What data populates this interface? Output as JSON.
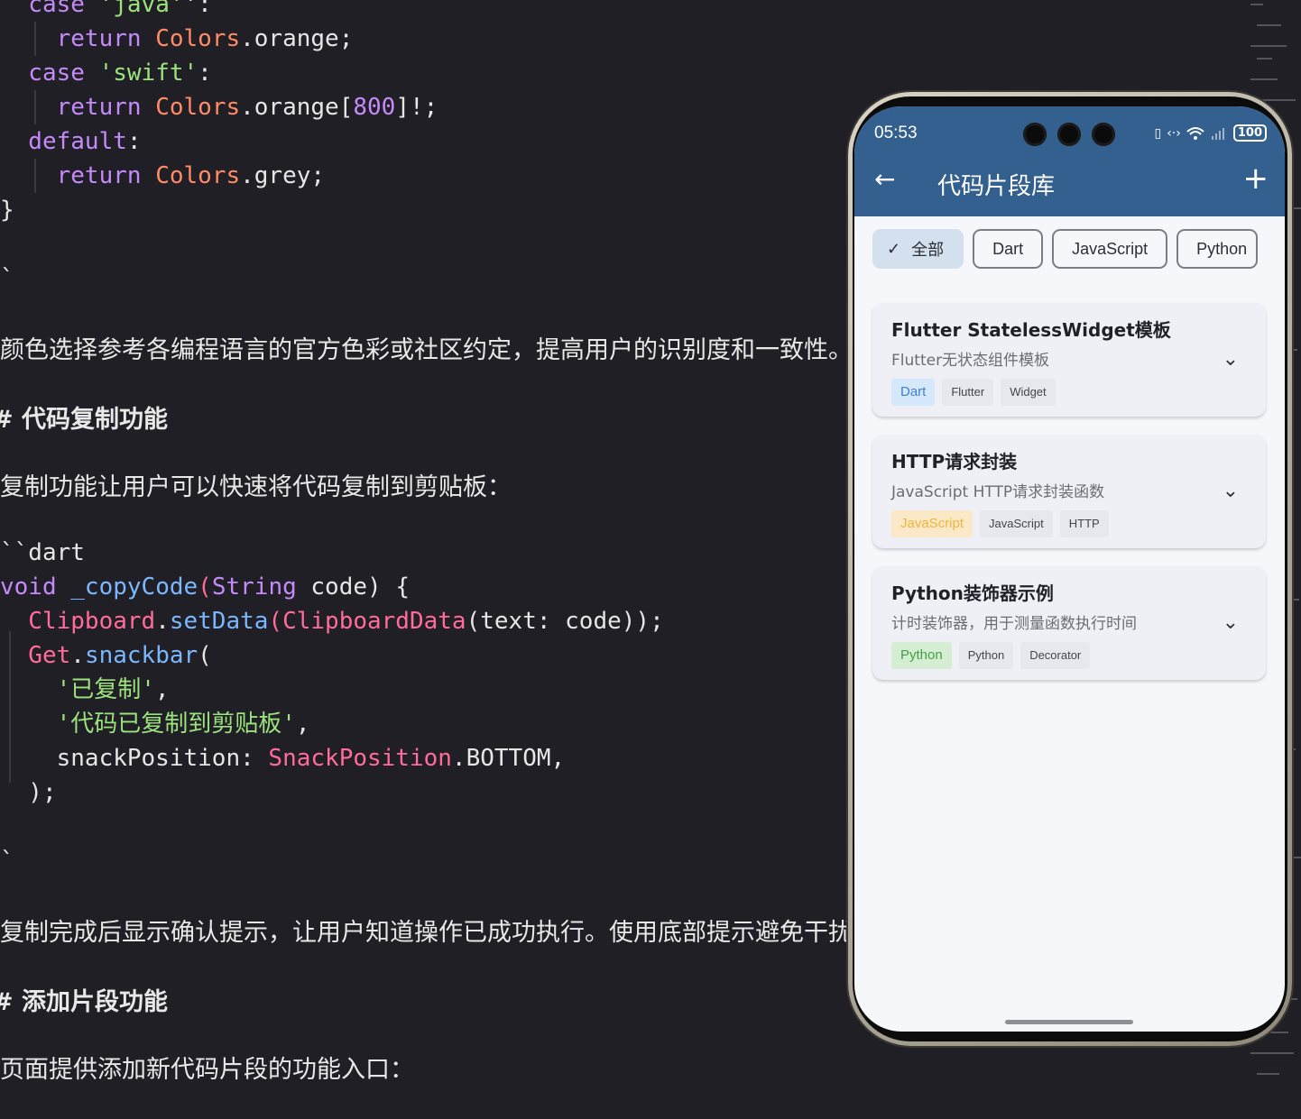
{
  "editor": {
    "code_top": [
      {
        "parts": [
          [
            "kw",
            "  case "
          ],
          [
            "str",
            "'java'"
          ],
          [
            "",
            "':"
          ]
        ]
      },
      {
        "parts": [
          [
            "",
            "    "
          ],
          [
            "kw",
            "return "
          ],
          [
            "cls",
            "Colors"
          ],
          [
            "",
            ".orange;"
          ]
        ]
      },
      {
        "parts": [
          [
            "kw",
            "  case "
          ],
          [
            "str",
            "'swift'"
          ],
          [
            "",
            ":"
          ]
        ]
      },
      {
        "parts": [
          [
            "",
            "    "
          ],
          [
            "kw",
            "return "
          ],
          [
            "cls",
            "Colors"
          ],
          [
            "",
            ".orange["
          ],
          [
            "num",
            "800"
          ],
          [
            "",
            "]!;"
          ]
        ]
      },
      {
        "parts": [
          [
            "kw",
            "  default"
          ],
          [
            "",
            ":"
          ]
        ]
      },
      {
        "parts": [
          [
            "",
            "    "
          ],
          [
            "kw",
            "return "
          ],
          [
            "cls",
            "Colors"
          ],
          [
            "",
            ".grey;"
          ]
        ]
      },
      {
        "parts": [
          [
            "",
            "}"
          ]
        ]
      },
      {
        "parts": [
          [
            "",
            ""
          ]
        ]
      },
      {
        "parts": [
          [
            "",
            "`"
          ]
        ]
      }
    ],
    "prose1": "颜色选择参考各编程语言的官方色彩或社区约定，提高用户的识别度和一致性。",
    "heading1": "# 代码复制功能",
    "prose2": "复制功能让用户可以快速将代码复制到剪贴板：",
    "code_mid": [
      {
        "parts": [
          [
            "",
            "``dart"
          ]
        ]
      },
      {
        "parts": [
          [
            "kw",
            "void "
          ],
          [
            "fn",
            "_copyCode"
          ],
          [
            "",
            ""
          ],
          [
            "pink",
            "("
          ],
          [
            "kw",
            "String"
          ],
          [
            "",
            " code) {"
          ]
        ]
      },
      {
        "parts": [
          [
            "",
            ""
          ],
          [
            "pink",
            "  Clipboard"
          ],
          [
            "",
            "."
          ],
          [
            "fn",
            "setData"
          ],
          [
            "pink",
            "("
          ],
          [
            "pink",
            "ClipboardData"
          ],
          [
            "",
            "(text: code));"
          ]
        ]
      },
      {
        "parts": [
          [
            "pink",
            "  Get"
          ],
          [
            "",
            "."
          ],
          [
            "fn",
            "snackbar"
          ],
          [
            "",
            "("
          ]
        ]
      },
      {
        "parts": [
          [
            "str",
            "    '已复制'"
          ],
          [
            "",
            ","
          ]
        ]
      },
      {
        "parts": [
          [
            "str",
            "    '代码已复制到剪贴板'"
          ],
          [
            "",
            ","
          ]
        ]
      },
      {
        "parts": [
          [
            "",
            "    snackPosition: "
          ],
          [
            "pink",
            "SnackPosition"
          ],
          [
            "",
            ".BOTTOM,"
          ]
        ]
      },
      {
        "parts": [
          [
            "",
            "  );"
          ]
        ]
      },
      {
        "parts": [
          [
            "",
            ""
          ]
        ]
      },
      {
        "parts": [
          [
            "",
            "`"
          ]
        ]
      }
    ],
    "prose3": "复制完成后显示确认提示，让用户知道操作已成功执行。使用底部提示避免干扰",
    "heading2": "# 添加片段功能",
    "prose4": "页面提供添加新代码片段的功能入口："
  },
  "phone": {
    "status": {
      "time": "05:53",
      "battery": "100"
    },
    "appbar": {
      "back_icon": "←",
      "title": "代码片段库",
      "add_icon": "+"
    },
    "filters": [
      {
        "label": "全部",
        "selected": true
      },
      {
        "label": "Dart",
        "selected": false
      },
      {
        "label": "JavaScript",
        "selected": false
      },
      {
        "label": "Python",
        "selected": false
      }
    ],
    "snippets": [
      {
        "title": "Flutter StatelessWidget模板",
        "desc": "Flutter无状态组件模板",
        "lang": "Dart",
        "lang_bg": "#d6e8fb",
        "lang_fg": "#3b82d6",
        "tags": [
          "Flutter",
          "Widget"
        ]
      },
      {
        "title": "HTTP请求封装",
        "desc": "JavaScript HTTP请求封装函数",
        "lang": "JavaScript",
        "lang_bg": "#fbe8c6",
        "lang_fg": "#f2b43a",
        "tags": [
          "JavaScript",
          "HTTP"
        ]
      },
      {
        "title": "Python装饰器示例",
        "desc": "计时装饰器，用于测量函数执行时间",
        "lang": "Python",
        "lang_bg": "#d4edd3",
        "lang_fg": "#43a047",
        "tags": [
          "Python",
          "Decorator"
        ]
      }
    ]
  }
}
